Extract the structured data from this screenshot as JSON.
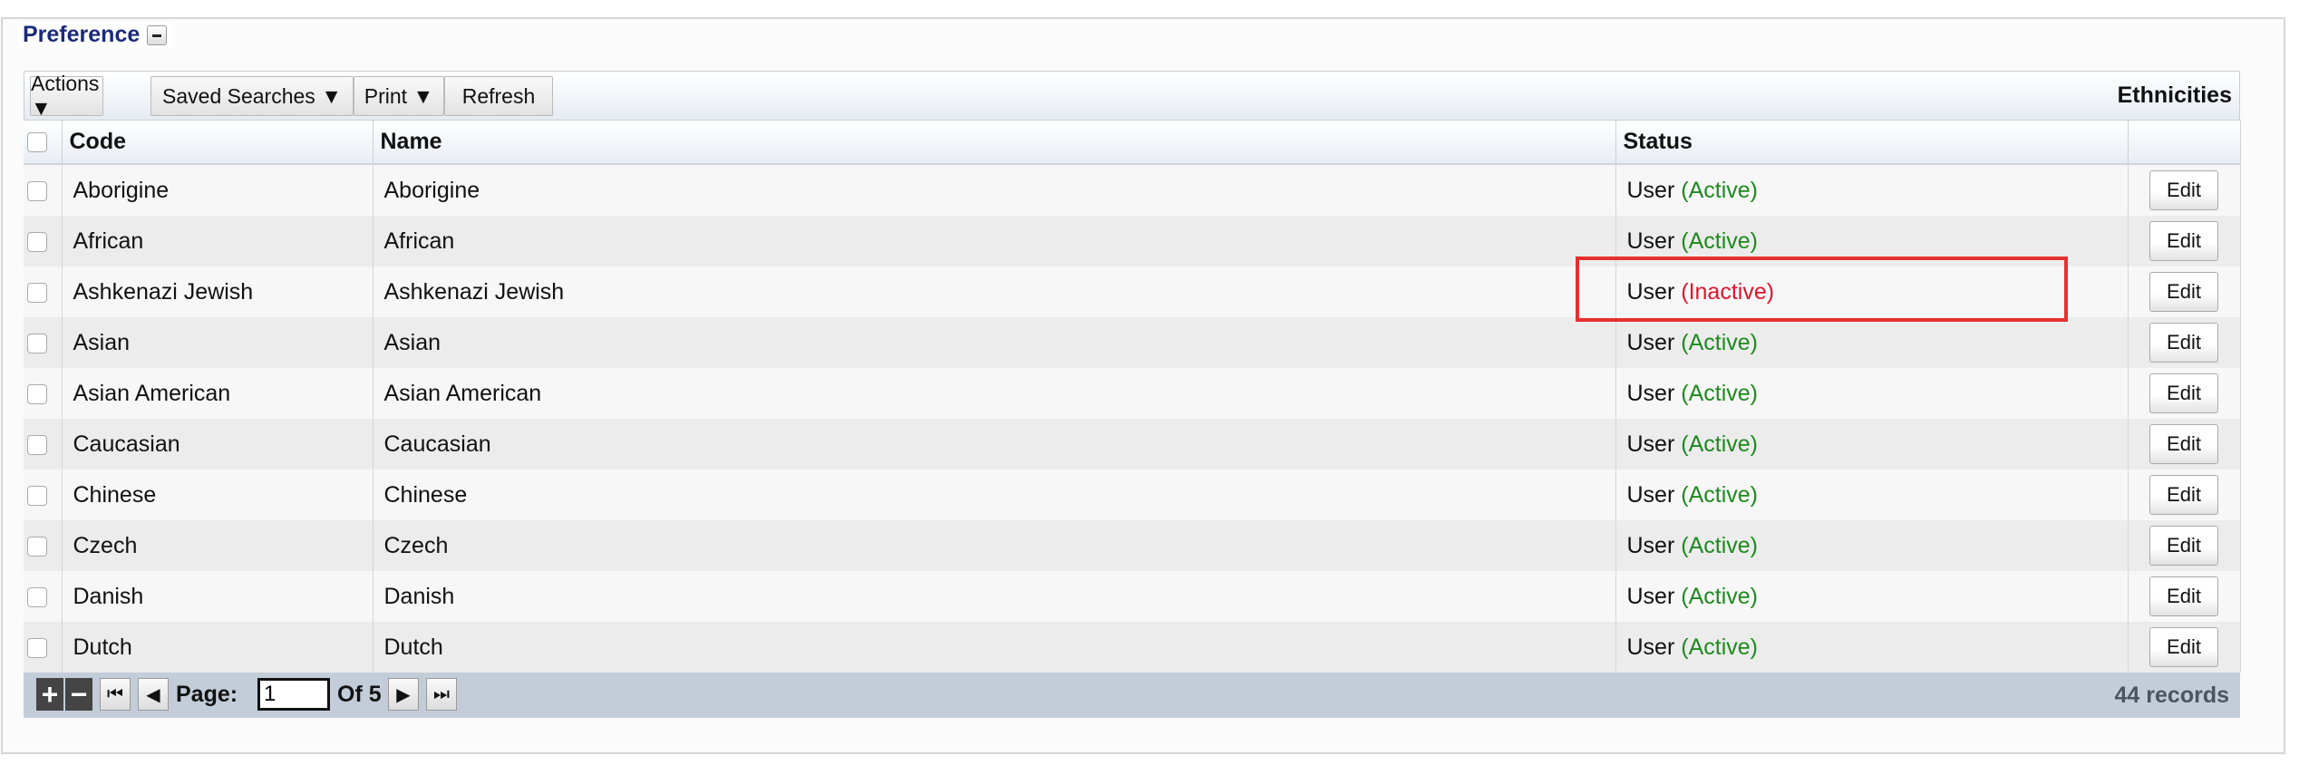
{
  "panel": {
    "title": "Preference",
    "collapse_icon": "minus-icon"
  },
  "toolbar": {
    "buttons": [
      {
        "label": "Actions ▼"
      },
      {
        "label": "Saved Searches ▼"
      },
      {
        "label": "Print ▼"
      },
      {
        "label": "Refresh"
      }
    ],
    "grid_title": "Ethnicities"
  },
  "table": {
    "columns": [
      "Code",
      "Name",
      "Status",
      ""
    ],
    "rows": [
      {
        "code": "Aborigine",
        "name": "Aborigine",
        "status_prefix": "User",
        "status": "(Active)",
        "active": true,
        "action": "Edit"
      },
      {
        "code": "African",
        "name": "African",
        "status_prefix": "User",
        "status": "(Active)",
        "active": true,
        "action": "Edit"
      },
      {
        "code": "Ashkenazi Jewish",
        "name": "Ashkenazi Jewish",
        "status_prefix": "User",
        "status": "(Inactive)",
        "active": false,
        "action": "Edit"
      },
      {
        "code": "Asian",
        "name": "Asian",
        "status_prefix": "User",
        "status": "(Active)",
        "active": true,
        "action": "Edit"
      },
      {
        "code": "Asian American",
        "name": "Asian American",
        "status_prefix": "User",
        "status": "(Active)",
        "active": true,
        "action": "Edit"
      },
      {
        "code": "Caucasian",
        "name": "Caucasian",
        "status_prefix": "User",
        "status": "(Active)",
        "active": true,
        "action": "Edit"
      },
      {
        "code": "Chinese",
        "name": "Chinese",
        "status_prefix": "User",
        "status": "(Active)",
        "active": true,
        "action": "Edit"
      },
      {
        "code": "Czech",
        "name": "Czech",
        "status_prefix": "User",
        "status": "(Active)",
        "active": true,
        "action": "Edit"
      },
      {
        "code": "Danish",
        "name": "Danish",
        "status_prefix": "User",
        "status": "(Active)",
        "active": true,
        "action": "Edit"
      },
      {
        "code": "Dutch",
        "name": "Dutch",
        "status_prefix": "User",
        "status": "(Active)",
        "active": true,
        "action": "Edit"
      }
    ]
  },
  "footer": {
    "add_icon": "+",
    "remove_icon": "−",
    "first_icon": "⏮",
    "prev_icon": "◀",
    "page_label": "Page:",
    "page_value": "1",
    "of_label": "Of 5",
    "next_icon": "▶",
    "last_icon": "⏭",
    "records": "44 records"
  },
  "colors": {
    "active": "#1e8a1e",
    "inactive": "#e0162b",
    "highlight": "#e53030",
    "legend": "#1a2a7a"
  }
}
